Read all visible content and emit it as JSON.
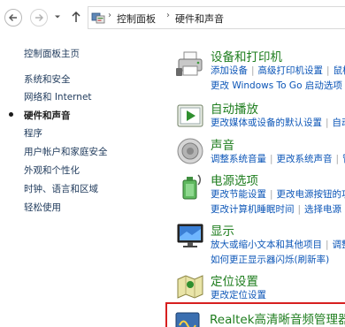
{
  "breadcrumb": {
    "items": [
      "控制面板",
      "硬件和声音"
    ]
  },
  "sidebar": {
    "items": [
      {
        "label": "控制面板主页",
        "active": false
      },
      {
        "label": "系统和安全",
        "active": false
      },
      {
        "label": "网络和 Internet",
        "active": false
      },
      {
        "label": "硬件和声音",
        "active": true
      },
      {
        "label": "程序",
        "active": false
      },
      {
        "label": "用户帐户和家庭安全",
        "active": false
      },
      {
        "label": "外观和个性化",
        "active": false
      },
      {
        "label": "时钟、语言和区域",
        "active": false
      },
      {
        "label": "轻松使用",
        "active": false
      }
    ]
  },
  "categories": [
    {
      "title": "设备和打印机",
      "icon": "printer-icon",
      "lines": [
        [
          "添加设备",
          "高级打印机设置",
          "鼠标"
        ],
        [
          "更改 Windows To Go 启动选项"
        ]
      ]
    },
    {
      "title": "自动播放",
      "icon": "autoplay-icon",
      "lines": [
        [
          "更改媒体或设备的默认设置",
          "自动播放"
        ]
      ]
    },
    {
      "title": "声音",
      "icon": "speaker-icon",
      "lines": [
        [
          "调整系统音量",
          "更改系统声音",
          "管理"
        ]
      ]
    },
    {
      "title": "电源选项",
      "icon": "power-icon",
      "lines": [
        [
          "更改节能设置",
          "更改电源按钮的功能"
        ],
        [
          "更改计算机睡眠时间",
          "选择电源"
        ]
      ]
    },
    {
      "title": "显示",
      "icon": "display-icon",
      "lines": [
        [
          "放大或缩小文本和其他项目",
          "调整屏幕"
        ],
        [
          "如何更正显示器闪烁(刷新率)"
        ]
      ]
    },
    {
      "title": "定位设置",
      "icon": "location-icon",
      "lines": [
        [
          "更改定位设置"
        ]
      ]
    },
    {
      "title": "Realtek高清晰音频管理器",
      "icon": "realtek-icon",
      "lines": []
    }
  ]
}
